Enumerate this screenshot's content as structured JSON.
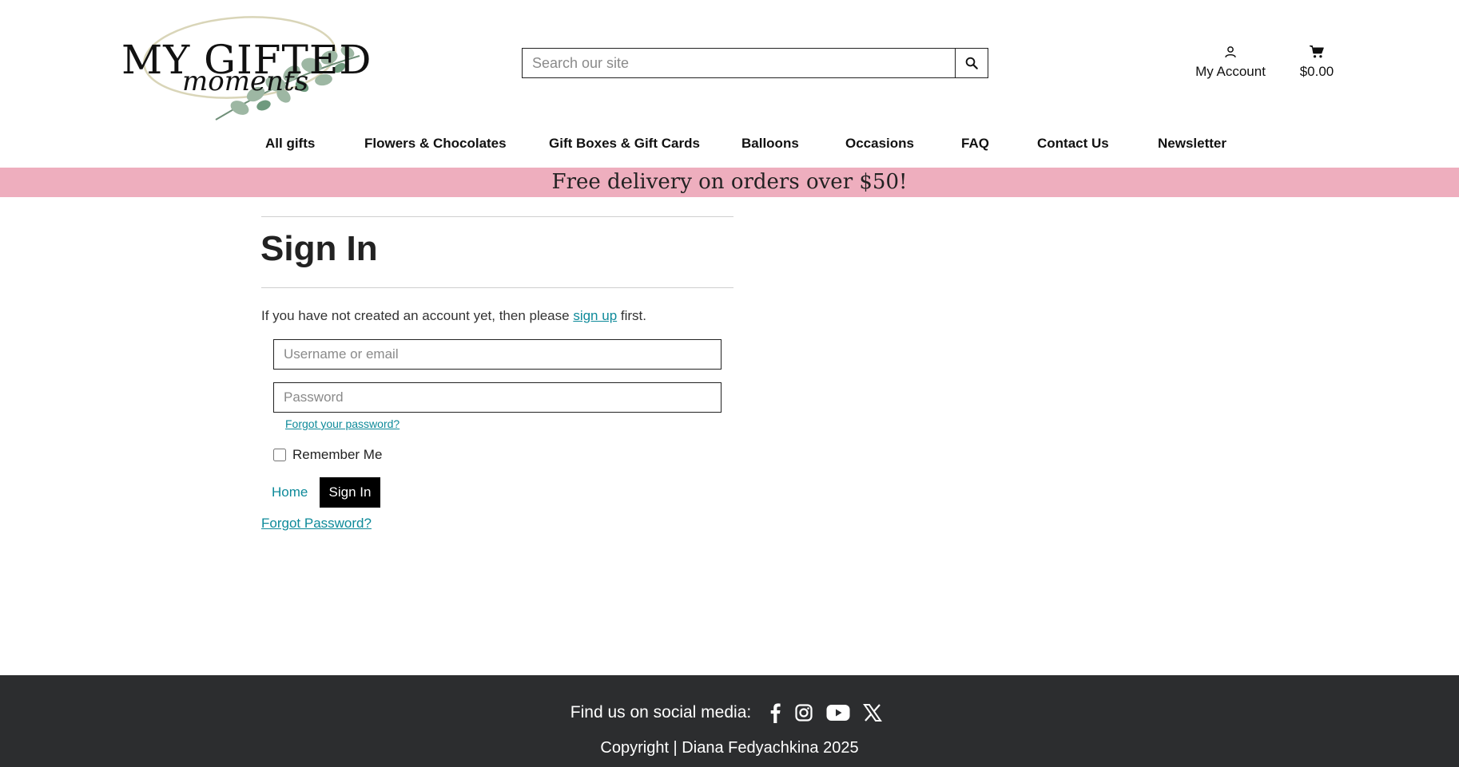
{
  "brand": {
    "name_line1": "MY GIFTED",
    "name_line2": "moments"
  },
  "header": {
    "search_placeholder": "Search our site",
    "account_label": "My Account",
    "cart_total": "$0.00"
  },
  "nav": {
    "items": [
      {
        "label": "All gifts"
      },
      {
        "label": "Flowers & Chocolates"
      },
      {
        "label": "Gift Boxes & Gift Cards"
      },
      {
        "label": "Balloons"
      },
      {
        "label": "Occasions"
      },
      {
        "label": "FAQ"
      },
      {
        "label": "Contact Us"
      },
      {
        "label": "Newsletter"
      }
    ]
  },
  "banner": {
    "text": "Free delivery on orders over $50!",
    "background": "#eeaebe"
  },
  "signin": {
    "title": "Sign In",
    "intro_before": "If you have not created an account yet, then please ",
    "intro_link": "sign up",
    "intro_after": " first.",
    "username_placeholder": "Username or email",
    "password_placeholder": "Password",
    "forgot_small": "Forgot your password?",
    "remember_label": "Remember Me",
    "remember_checked": false,
    "home_link": "Home",
    "submit_label": "Sign In",
    "forgot_big": "Forgot Password?"
  },
  "footer": {
    "social_label": "Find us on social media:",
    "social_icons": [
      "facebook-icon",
      "instagram-icon",
      "youtube-icon",
      "x-icon"
    ],
    "copyright": "Copyright | Diana Fedyachkina 2025",
    "background": "#2c2d2f"
  },
  "colors": {
    "link": "#0e8a9a",
    "button": "#000000"
  }
}
